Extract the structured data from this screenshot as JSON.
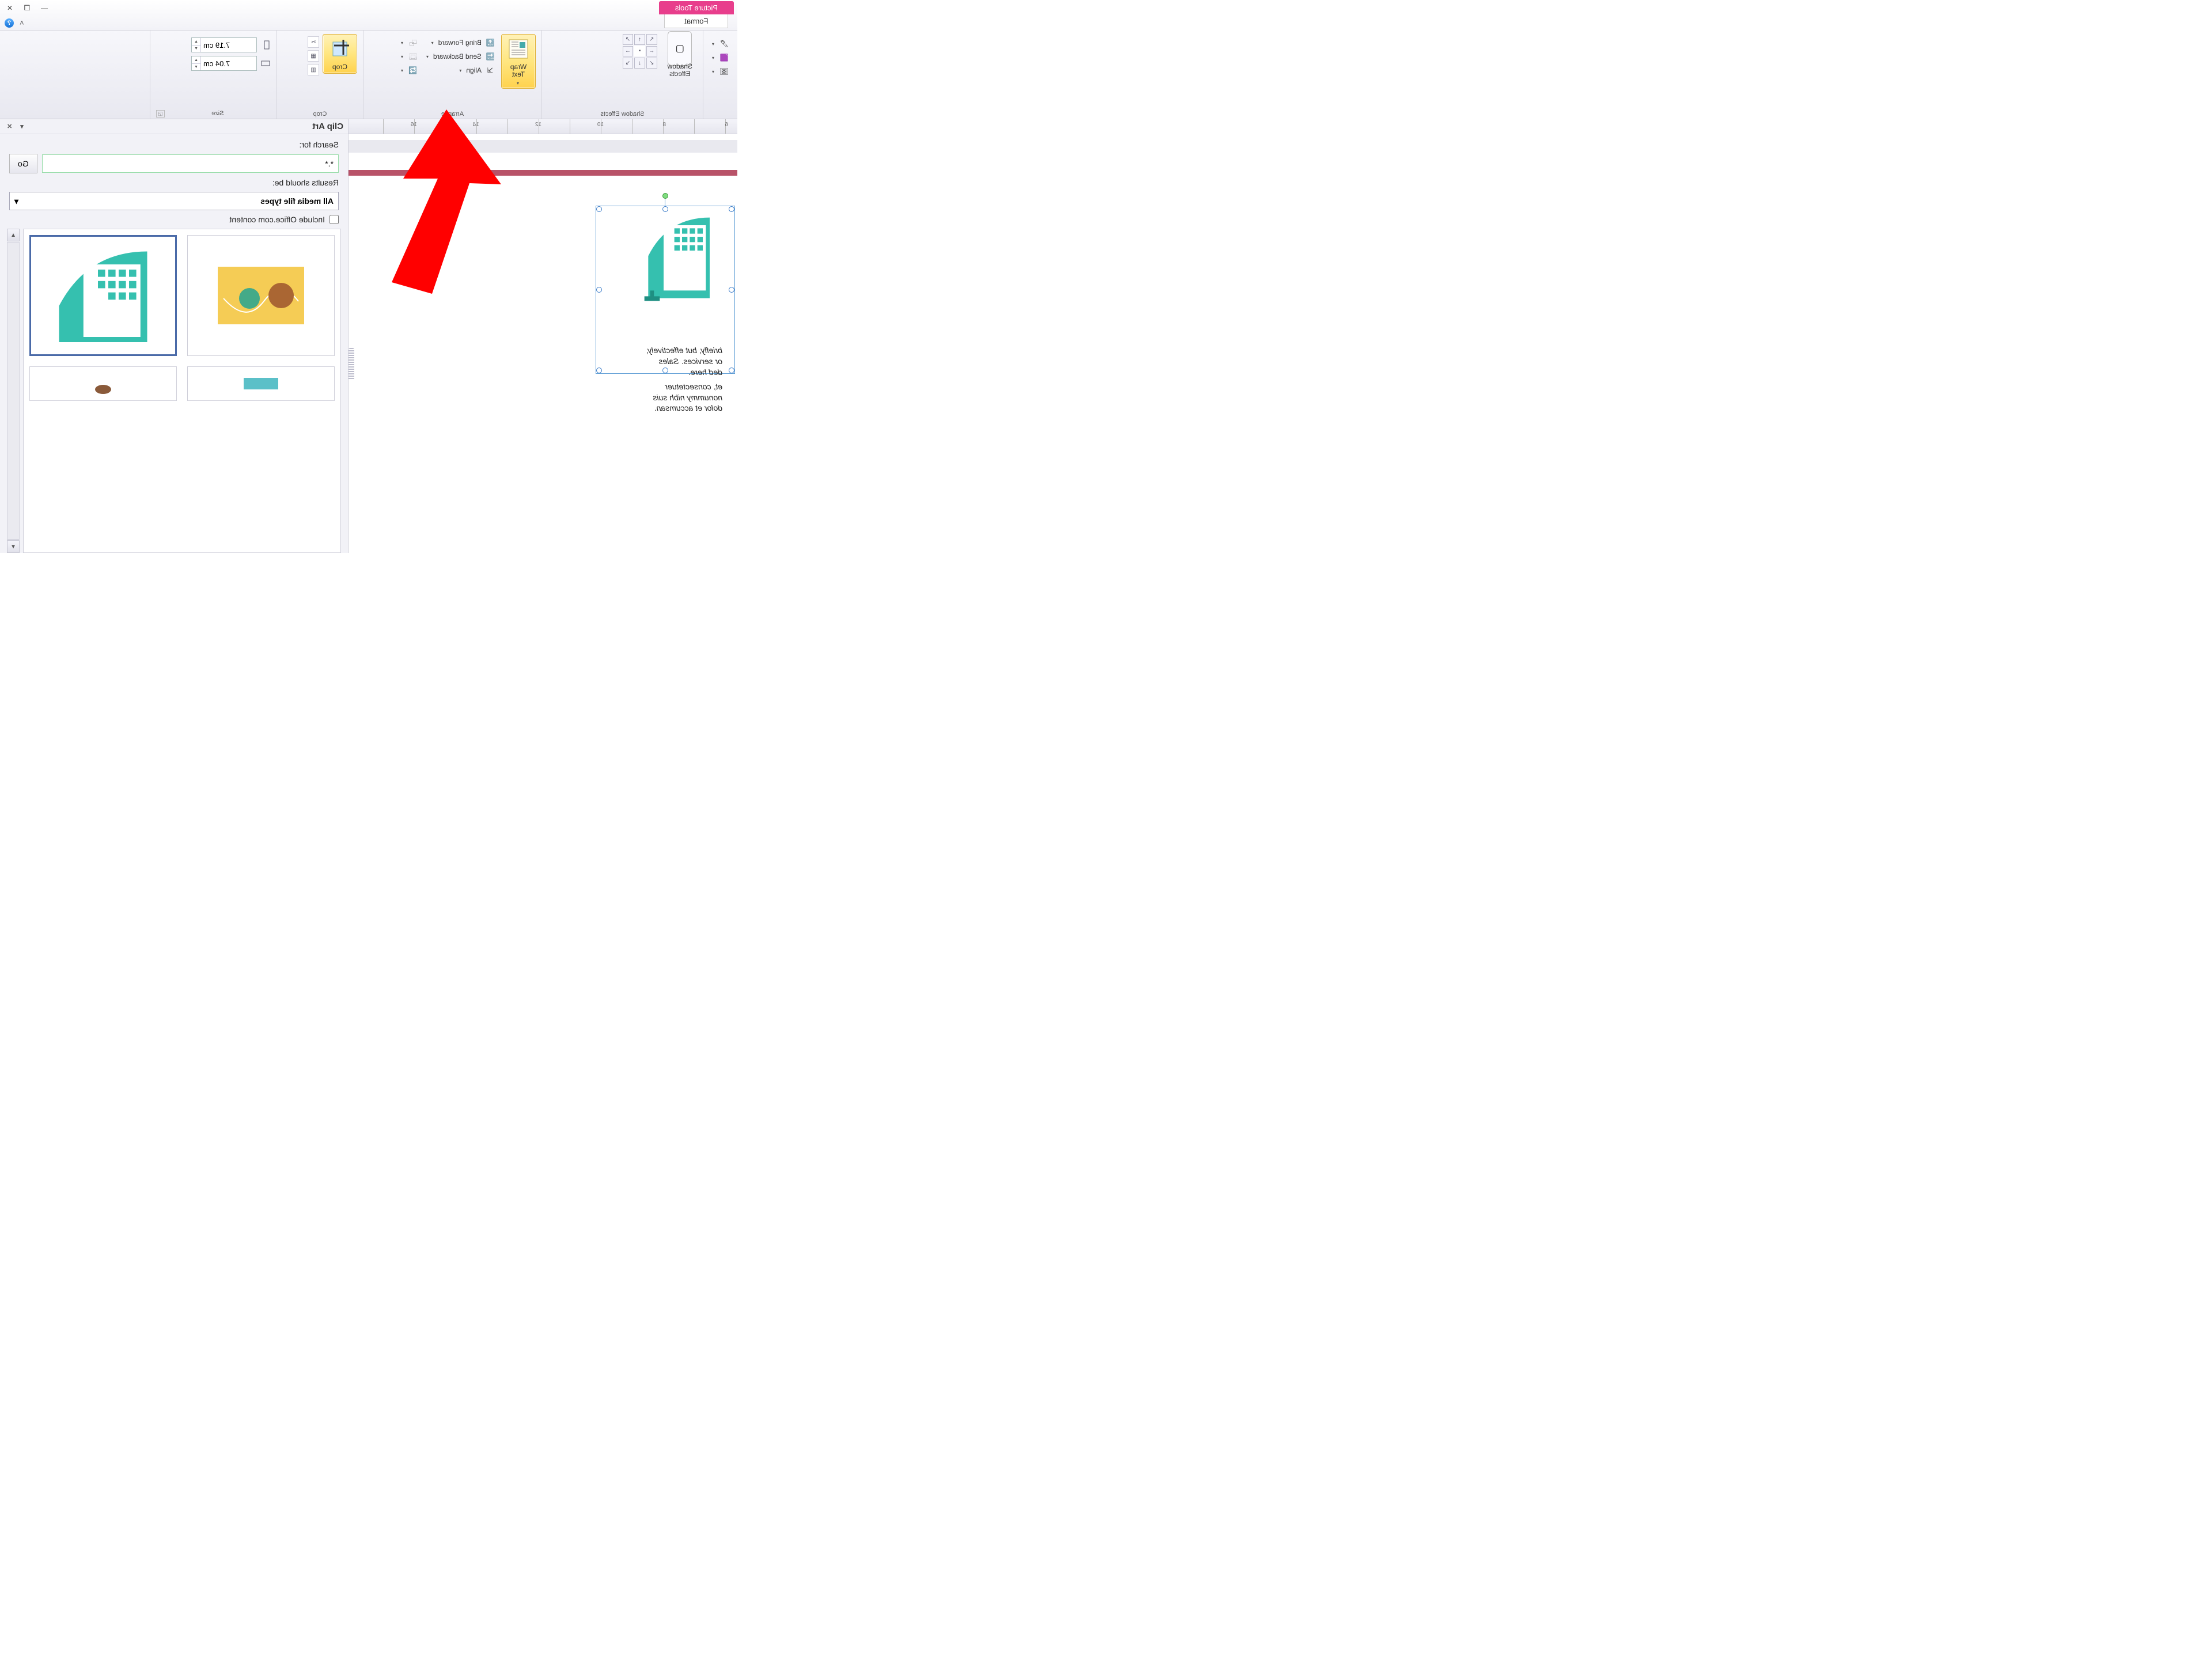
{
  "title_tab": {
    "context": "Picture Tools",
    "ribbon_tab": "Format"
  },
  "window_controls": {
    "minimize": "—",
    "restore": "❐",
    "close": "✕"
  },
  "help": {
    "icon": "?",
    "collapse": "˄"
  },
  "ribbon": {
    "shadow_effects": {
      "label": "Shadow Effects",
      "shadow_effects_btn": "Shadow\nEffects",
      "shape_outline": "",
      "shape_fill": "",
      "change_pic": ""
    },
    "arrange": {
      "label": "Arrange",
      "wrap_text": "Wrap\nText",
      "bring_forward": "Bring Forward",
      "send_backward": "Send Backward",
      "align": "Align",
      "group": "",
      "rotate": ""
    },
    "crop": {
      "label": "Crop",
      "crop_btn": "Crop"
    },
    "size": {
      "label": "Size",
      "height": "7.19 cm",
      "width": "7.04 cm"
    }
  },
  "ruler_numbers": [
    "6",
    "",
    "8",
    "",
    "10",
    "",
    "12",
    "",
    "14",
    "",
    "16",
    ""
  ],
  "picture": {
    "caption_line1": "briefly, but effectively,",
    "caption_line2": "or services. Sales",
    "caption_line3": "ded here.",
    "caption_line4": "et, consectetuer",
    "caption_line5": "nonummy nibh suis",
    "caption_line6": "dolor et accumsan."
  },
  "clipart": {
    "title": "Clip Art",
    "search_for_label": "Search for:",
    "search_value": "*.*",
    "go": "Go",
    "results_label": "Results should be:",
    "results_value": "All media file types",
    "include_label": "Include Office.com content"
  }
}
